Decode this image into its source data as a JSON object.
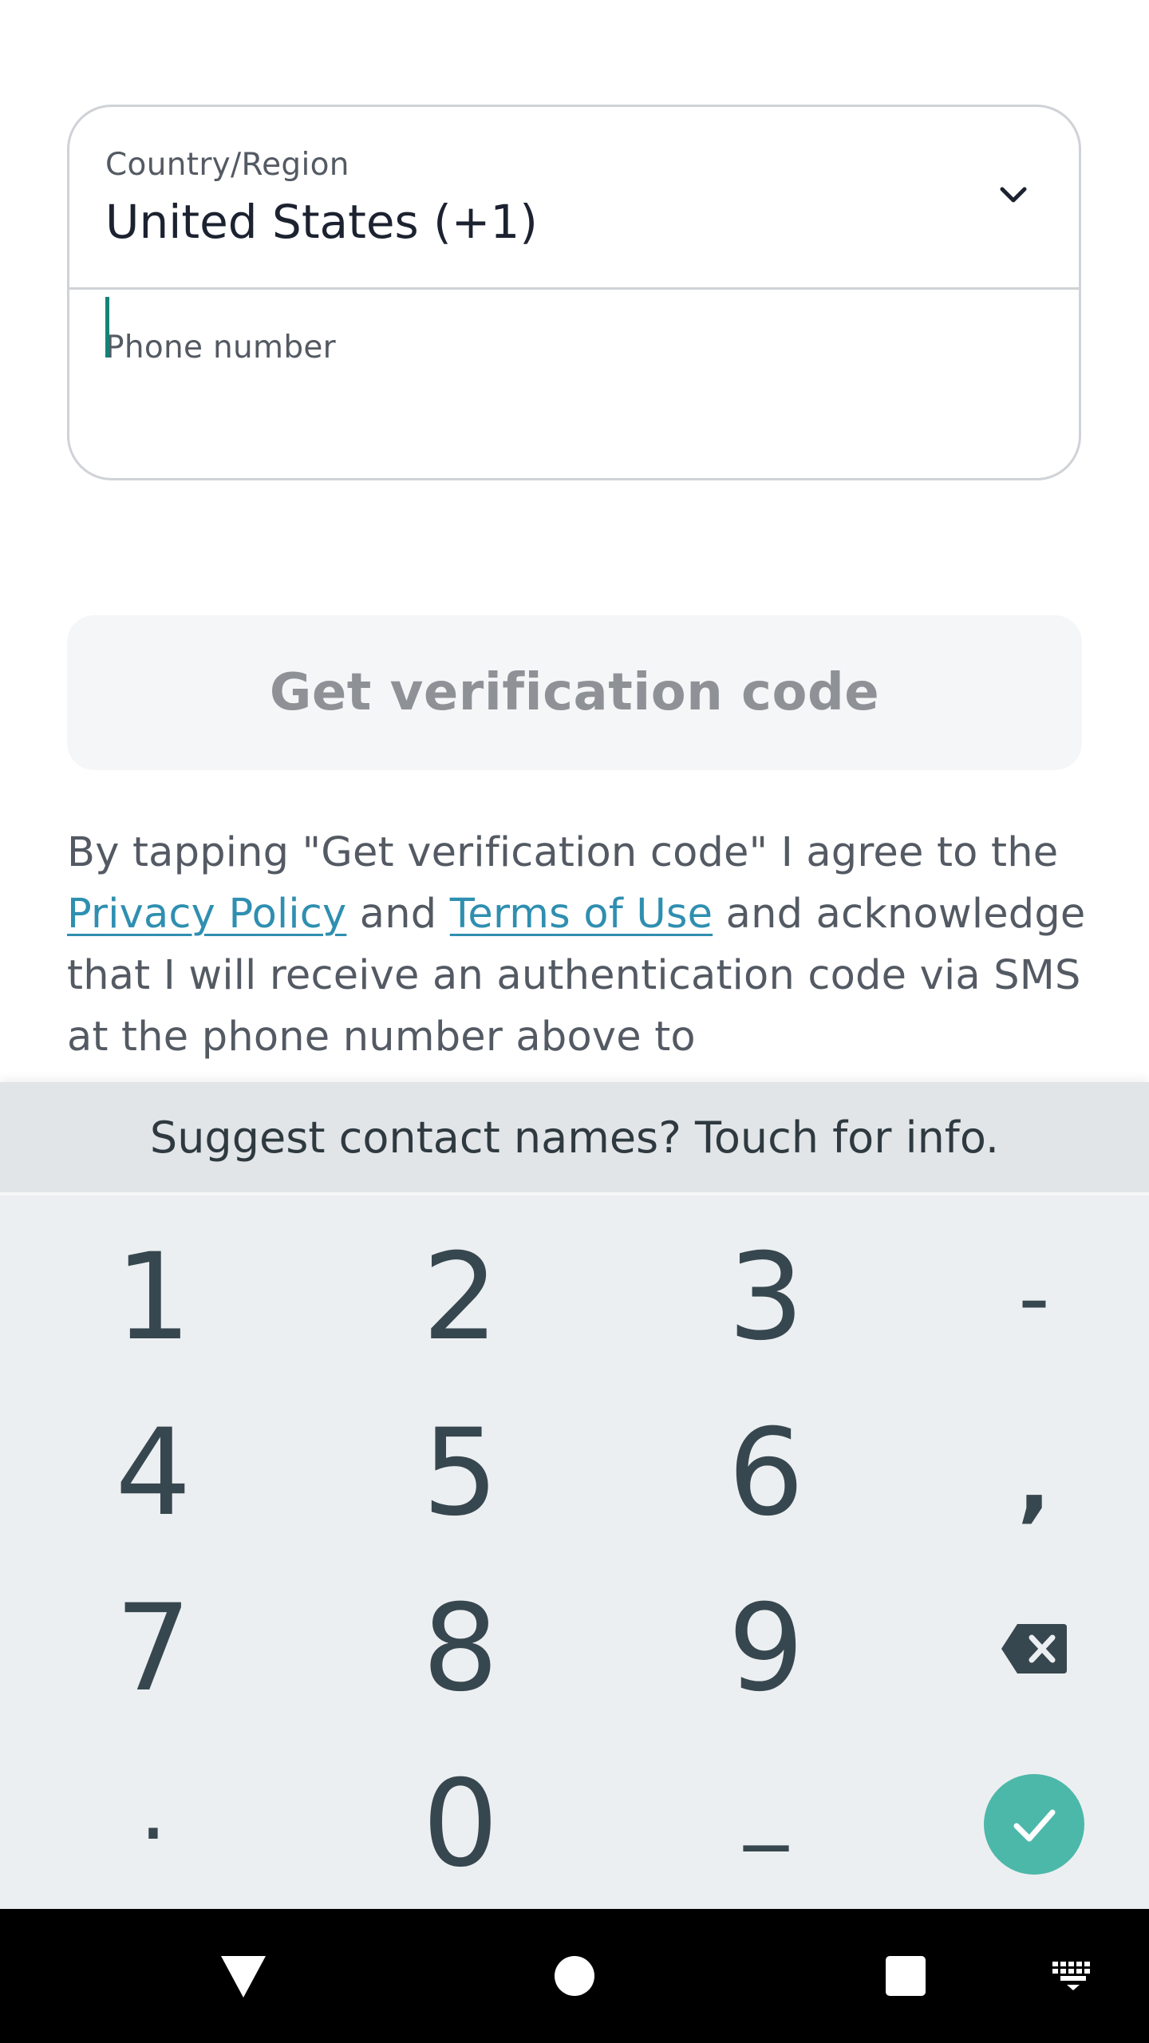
{
  "form": {
    "country_label": "Country/Region",
    "country_value": "United States (+1)",
    "phone_label": "Phone number",
    "phone_value": "",
    "phone_placeholder": ""
  },
  "verify_button": {
    "label": "Get verification code"
  },
  "terms": {
    "prefix": "By tapping \"Get verification code\" I agree to the ",
    "privacy_link": "Privacy Policy",
    "middle": " and ",
    "terms_link": "Terms of Use",
    "suffix": " and acknowledge that I will receive an authentication code via SMS at the phone number above to"
  },
  "keyboard": {
    "suggestion": "Suggest contact names? Touch for info.",
    "keys": {
      "k1": "1",
      "k2": "2",
      "k3": "3",
      "dash": "-",
      "k4": "4",
      "k5": "5",
      "k6": "6",
      "comma": ",",
      "k7": "7",
      "k8": "8",
      "k9": "9",
      "period": ".",
      "k0": "0",
      "underscore": "_"
    },
    "accent_color": "#4cb8a9"
  },
  "navbar": {
    "icons": [
      "back-icon",
      "home-icon",
      "recents-icon",
      "keyboard-switch-icon"
    ]
  }
}
